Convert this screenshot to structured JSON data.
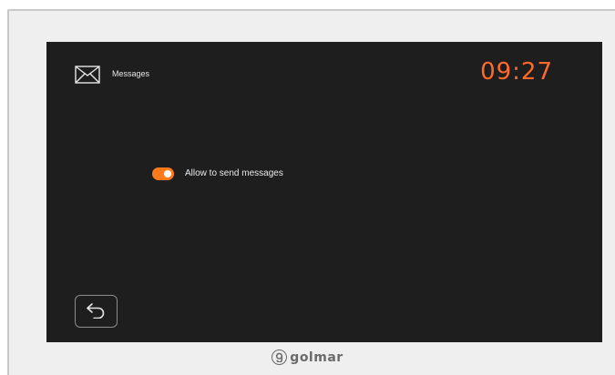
{
  "header": {
    "title": "Messages",
    "icon": "envelope-icon",
    "clock": "09:27"
  },
  "settings": {
    "allow_messages": {
      "label": "Allow to send messages",
      "enabled": true
    }
  },
  "footer": {
    "back_icon": "back-arrow-icon",
    "brand": "golmar"
  },
  "colors": {
    "accent": "#ff6a2b",
    "screen_bg": "#1e1e1e",
    "toggle_on": "#ff7a1a"
  }
}
